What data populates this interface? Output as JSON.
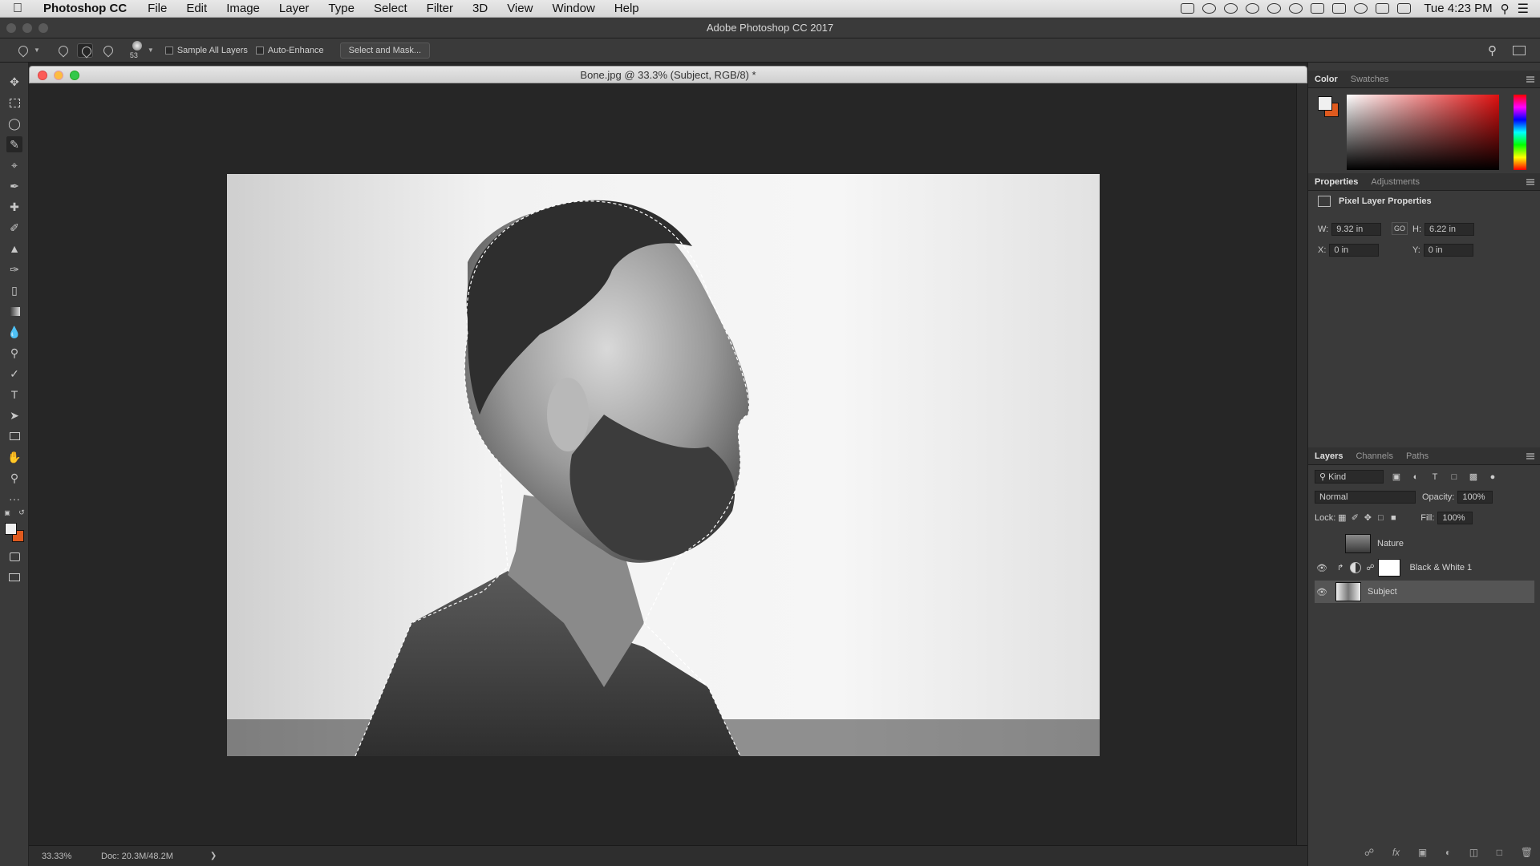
{
  "menubar": {
    "app_name": "Photoshop CC",
    "items": [
      "File",
      "Edit",
      "Image",
      "Layer",
      "Type",
      "Select",
      "Filter",
      "3D",
      "View",
      "Window",
      "Help"
    ],
    "clock": "Tue 4:23 PM"
  },
  "app_title": "Adobe Photoshop CC 2017",
  "options": {
    "brush_size": "53",
    "sample_all_layers": "Sample All Layers",
    "auto_enhance": "Auto-Enhance",
    "select_and_mask": "Select and Mask..."
  },
  "document": {
    "title": "Bone.jpg @ 33.3% (Subject, RGB/8) *",
    "zoom": "33.33%",
    "doc_size": "Doc: 20.3M/48.2M"
  },
  "color_panel": {
    "tabs": [
      "Color",
      "Swatches"
    ],
    "accent": "#e05a1e"
  },
  "properties_panel": {
    "tabs": [
      "Properties",
      "Adjustments"
    ],
    "heading": "Pixel Layer Properties",
    "w_label": "W:",
    "w_value": "9.32 in",
    "h_label": "H:",
    "h_value": "6.22 in",
    "x_label": "X:",
    "x_value": "0 in",
    "y_label": "Y:",
    "y_value": "0 in",
    "link_label": "GO"
  },
  "layers_panel": {
    "tabs": [
      "Layers",
      "Channels",
      "Paths"
    ],
    "filter": "Kind",
    "blend_mode": "Normal",
    "opacity_label": "Opacity:",
    "opacity": "100%",
    "lock_label": "Lock:",
    "fill_label": "Fill:",
    "fill": "100%",
    "layers": [
      {
        "name": "Nature",
        "visible": false
      },
      {
        "name": "Black & White 1",
        "visible": true
      },
      {
        "name": "Subject",
        "visible": true,
        "selected": true
      }
    ]
  }
}
